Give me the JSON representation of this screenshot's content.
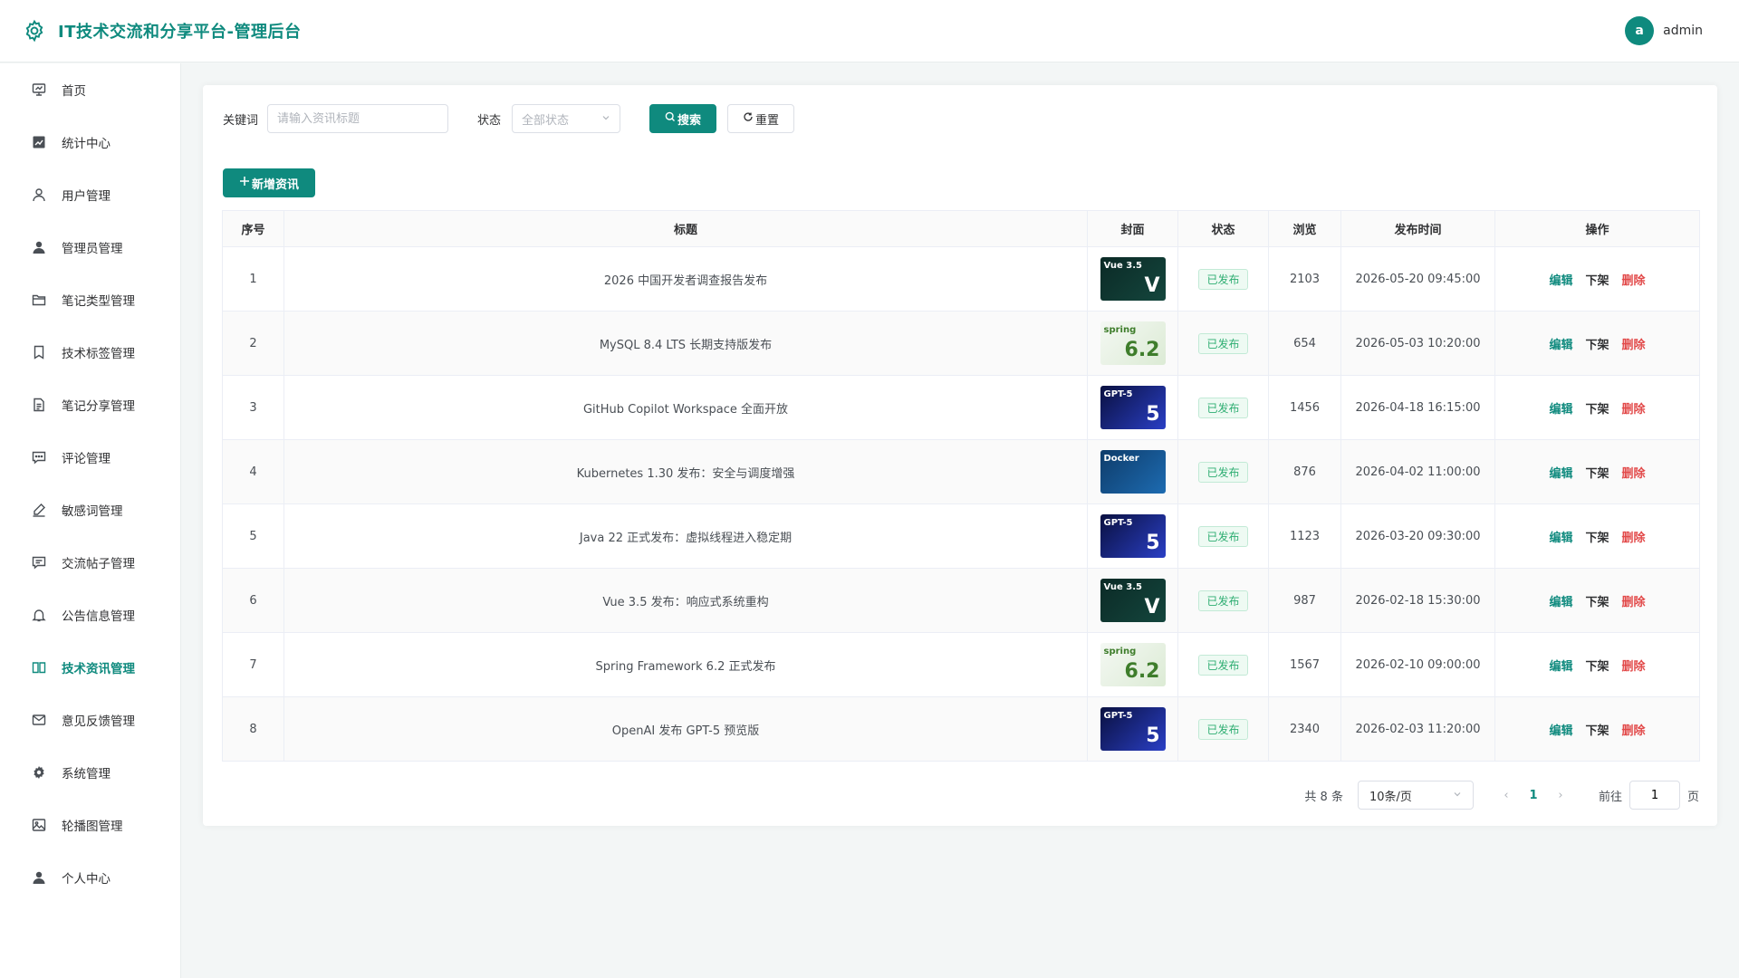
{
  "header": {
    "title": "IT技术交流和分享平台-管理后台",
    "user_avatar": "a",
    "user_name": "admin"
  },
  "sidebar": {
    "items": [
      {
        "label": "首页",
        "icon": "monitor-icon"
      },
      {
        "label": "统计中心",
        "icon": "chart-icon"
      },
      {
        "label": "用户管理",
        "icon": "user-icon"
      },
      {
        "label": "管理员管理",
        "icon": "admin-icon"
      },
      {
        "label": "笔记类型管理",
        "icon": "folder-icon"
      },
      {
        "label": "技术标签管理",
        "icon": "bookmark-icon"
      },
      {
        "label": "笔记分享管理",
        "icon": "document-icon"
      },
      {
        "label": "评论管理",
        "icon": "comment-icon"
      },
      {
        "label": "敏感词管理",
        "icon": "edit-icon"
      },
      {
        "label": "交流帖子管理",
        "icon": "chat-icon"
      },
      {
        "label": "公告信息管理",
        "icon": "bell-icon"
      },
      {
        "label": "技术资讯管理",
        "icon": "book-icon"
      },
      {
        "label": "意见反馈管理",
        "icon": "mail-icon"
      },
      {
        "label": "系统管理",
        "icon": "gear-icon"
      },
      {
        "label": "轮播图管理",
        "icon": "image-icon"
      },
      {
        "label": "个人中心",
        "icon": "person-icon"
      }
    ],
    "active_index": 11
  },
  "search": {
    "keyword_label": "关键词",
    "keyword_placeholder": "请输入资讯标题",
    "status_label": "状态",
    "status_placeholder": "全部状态",
    "search_button": "搜索",
    "reset_button": "重置"
  },
  "add_button": "新增资讯",
  "table": {
    "headers": [
      "序号",
      "标题",
      "封面",
      "状态",
      "浏览",
      "发布时间",
      "操作"
    ],
    "rows": [
      {
        "no": "1",
        "title": "2026 中国开发者调查报告发布",
        "cover": "vue",
        "cover_text": "Vue 3.5",
        "cover_big": "V",
        "status": "已发布",
        "views": "2103",
        "time": "2026-05-20 09:45:00"
      },
      {
        "no": "2",
        "title": "MySQL 8.4 LTS 长期支持版发布",
        "cover": "spring",
        "cover_text": "spring",
        "cover_big": "6.2",
        "status": "已发布",
        "views": "654",
        "time": "2026-05-03 10:20:00"
      },
      {
        "no": "3",
        "title": "GitHub Copilot Workspace 全面开放",
        "cover": "gpt",
        "cover_text": "GPT-5",
        "cover_big": "5",
        "status": "已发布",
        "views": "1456",
        "time": "2026-04-18 16:15:00"
      },
      {
        "no": "4",
        "title": "Kubernetes 1.30 发布：安全与调度增强",
        "cover": "docker",
        "cover_text": "Docker",
        "cover_big": "",
        "status": "已发布",
        "views": "876",
        "time": "2026-04-02 11:00:00"
      },
      {
        "no": "5",
        "title": "Java 22 正式发布：虚拟线程进入稳定期",
        "cover": "gpt",
        "cover_text": "GPT-5",
        "cover_big": "5",
        "status": "已发布",
        "views": "1123",
        "time": "2026-03-20 09:30:00"
      },
      {
        "no": "6",
        "title": "Vue 3.5 发布：响应式系统重构",
        "cover": "vue",
        "cover_text": "Vue 3.5",
        "cover_big": "V",
        "status": "已发布",
        "views": "987",
        "time": "2026-02-18 15:30:00"
      },
      {
        "no": "7",
        "title": "Spring Framework 6.2 正式发布",
        "cover": "spring",
        "cover_text": "spring",
        "cover_big": "6.2",
        "status": "已发布",
        "views": "1567",
        "time": "2026-02-10 09:00:00"
      },
      {
        "no": "8",
        "title": "OpenAI 发布 GPT-5 预览版",
        "cover": "gpt",
        "cover_text": "GPT-5",
        "cover_big": "5",
        "status": "已发布",
        "views": "2340",
        "time": "2026-02-03 11:20:00"
      }
    ],
    "actions": {
      "edit": "编辑",
      "offline": "下架",
      "delete": "删除"
    }
  },
  "pagination": {
    "total": "共 8 条",
    "page_size": "10条/页",
    "current_page": "1",
    "goto_label": "前往",
    "goto_value": "1",
    "page_suffix": "页"
  },
  "colors": {
    "accent": "#0f8a7e",
    "danger": "#e24a4a",
    "success": "#2fae72"
  }
}
